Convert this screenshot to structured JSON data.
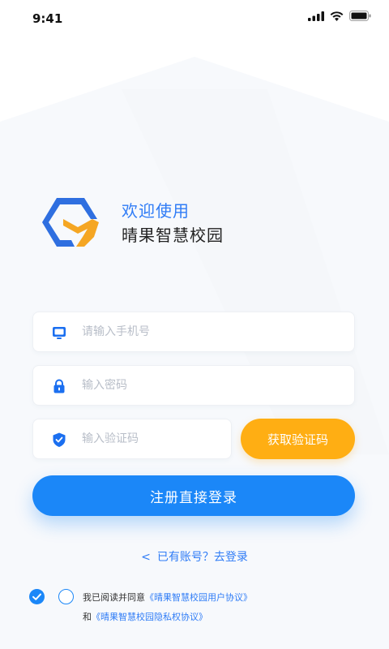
{
  "status_bar": {
    "time": "9:41",
    "icons": [
      "signal-icon",
      "wifi-icon",
      "battery-icon"
    ]
  },
  "brand": {
    "welcome": "欢迎使用",
    "app_name": "晴果智慧校园",
    "logo_colors": {
      "blue": "#2f6fe0",
      "orange": "#f5a623"
    }
  },
  "form": {
    "phone_placeholder": "请输入手机号",
    "password_placeholder": "输入密码",
    "code_placeholder": "输入验证码",
    "get_code_label": "获取验证码",
    "register_label": "注册直接登录"
  },
  "login_link": {
    "arrow": "<",
    "label": "已有账号？去登录"
  },
  "agreement": {
    "prefix": "我已阅读并同意",
    "user_agreement": "《晴果智慧校园用户协议》",
    "and": "和",
    "privacy_agreement": "《晴果智慧校园隐私权协议》"
  },
  "colors": {
    "primary": "#1b87f8",
    "accent": "#ffae13",
    "link": "#2f7cf6"
  }
}
